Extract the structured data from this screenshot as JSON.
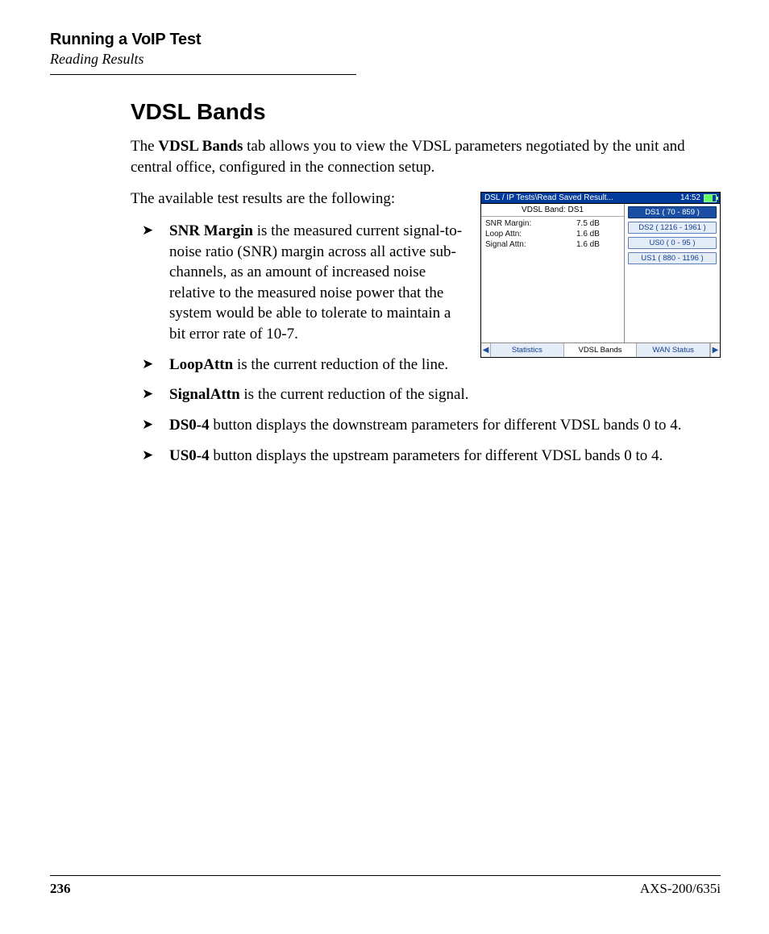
{
  "header": {
    "running_head": "Running a VoIP Test",
    "subhead": "Reading Results"
  },
  "section": {
    "title": "VDSL Bands",
    "intro_pre": "The ",
    "intro_bold": "VDSL Bands",
    "intro_post": " tab allows you to view the VDSL parameters negotiated by the unit and central office, configured in the connection setup.",
    "available": "The available test results are the following:"
  },
  "bullets": {
    "snr_bold": "SNR Margin",
    "snr_rest": " is the measured current signal-to-noise ratio (SNR) margin across all active sub-channels, as an amount of increased noise relative to the measured noise power that the system would be able to tolerate to maintain a bit error rate of 10-7.",
    "loop_bold": "LoopAttn",
    "loop_rest": " is the current reduction of the line.",
    "sig_bold": "SignalAttn",
    "sig_rest": " is the current reduction of the signal.",
    "ds_bold": "DS0-4",
    "ds_rest": " button displays the downstream parameters for different VDSL bands 0 to 4.",
    "us_bold": "US0-4",
    "us_rest": " button displays the upstream parameters for different VDSL bands 0 to 4."
  },
  "device": {
    "title_path": "DSL / IP Tests\\Read Saved Result...",
    "clock": "14:52",
    "band_title": "VDSL Band: DS1",
    "rows": [
      {
        "label": "SNR Margin:",
        "value": "7.5  dB"
      },
      {
        "label": "Loop Attn:",
        "value": "1.6  dB"
      },
      {
        "label": "Signal Attn:",
        "value": "1.6  dB"
      }
    ],
    "band_buttons": [
      {
        "label": "DS1 (  70 - 859  )",
        "selected": true
      },
      {
        "label": "DS2 (  1216 - 1961  )",
        "selected": false
      },
      {
        "label": "US0 (  0 - 95  )",
        "selected": false
      },
      {
        "label": "US1 (  880 - 1196  )",
        "selected": false
      }
    ],
    "bottom_tabs": {
      "left": "Statistics",
      "center": "VDSL Bands",
      "right": "WAN Status"
    }
  },
  "footer": {
    "page_no": "236",
    "model": "AXS-200/635i"
  }
}
